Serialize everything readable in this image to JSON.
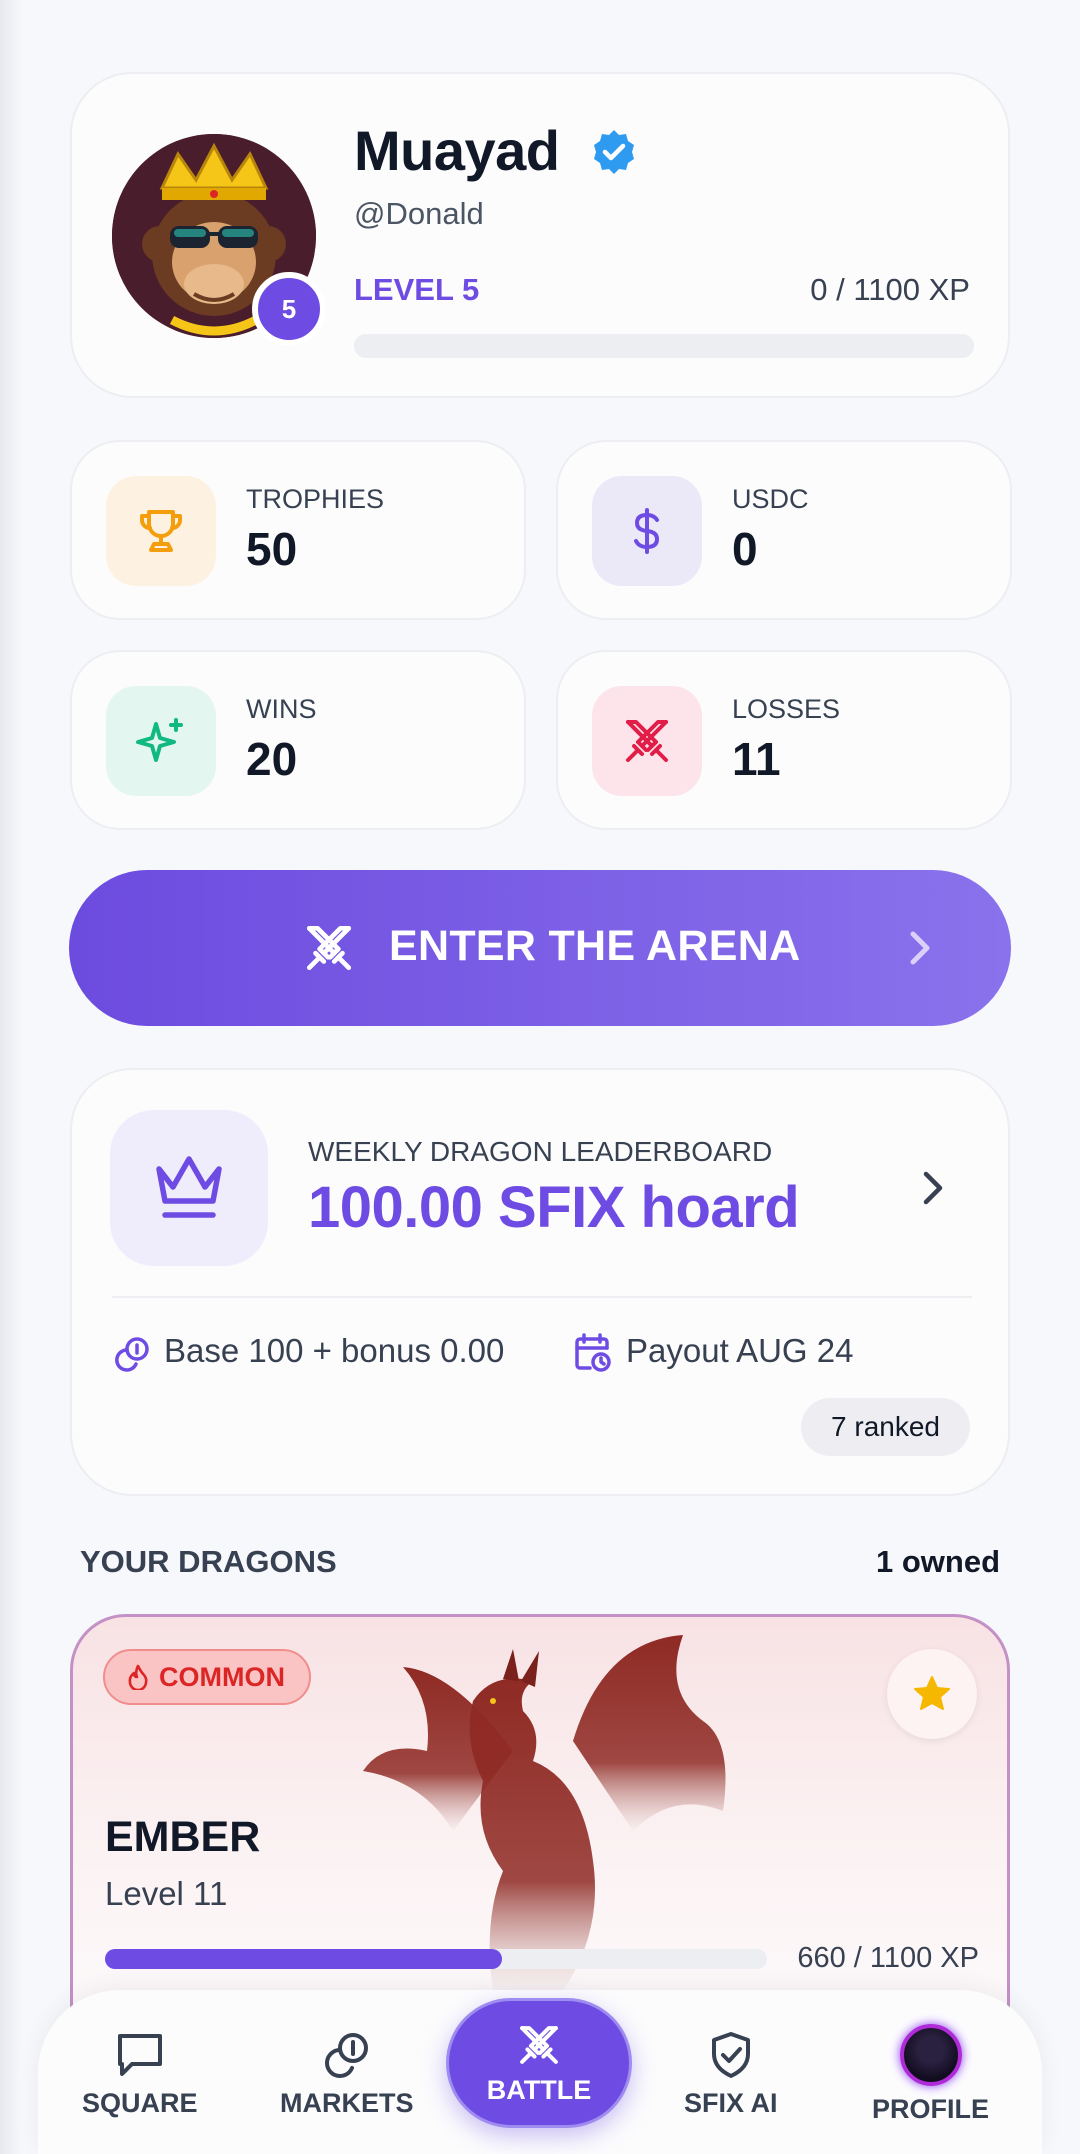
{
  "profile": {
    "name": "Muayad",
    "handle": "@Donald",
    "level_badge": "5",
    "level_label": "LEVEL 5",
    "xp_label": "0 / 1100 XP",
    "xp_progress": 0
  },
  "stats": {
    "trophies": {
      "label": "TROPHIES",
      "value": "50"
    },
    "usdc": {
      "label": "USDC",
      "value": "0"
    },
    "wins": {
      "label": "WINS",
      "value": "20"
    },
    "losses": {
      "label": "LOSSES",
      "value": "11"
    }
  },
  "arena": {
    "label": "ENTER THE ARENA"
  },
  "leaderboard": {
    "title": "WEEKLY DRAGON LEADERBOARD",
    "amount": "100.00 SFIX hoard",
    "base": "Base 100 + bonus 0.00",
    "payout": "Payout AUG 24",
    "ranked": "7 ranked"
  },
  "dragons": {
    "section_title": "YOUR DRAGONS",
    "owned": "1 owned",
    "items": [
      {
        "rarity": "COMMON",
        "name": "EMBER",
        "level": "Level 11",
        "xp_label": "660 / 1100 XP",
        "xp_progress": 0.6
      }
    ]
  },
  "nav": {
    "square": "SQUARE",
    "markets": "MARKETS",
    "battle": "BATTLE",
    "sfix_ai": "SFIX AI",
    "profile": "PROFILE"
  },
  "colors": {
    "accent": "#6e4ce3",
    "trophy": "#f59e0b",
    "win": "#10b981",
    "loss": "#e11d48",
    "rarity_common": "#dc2626"
  }
}
